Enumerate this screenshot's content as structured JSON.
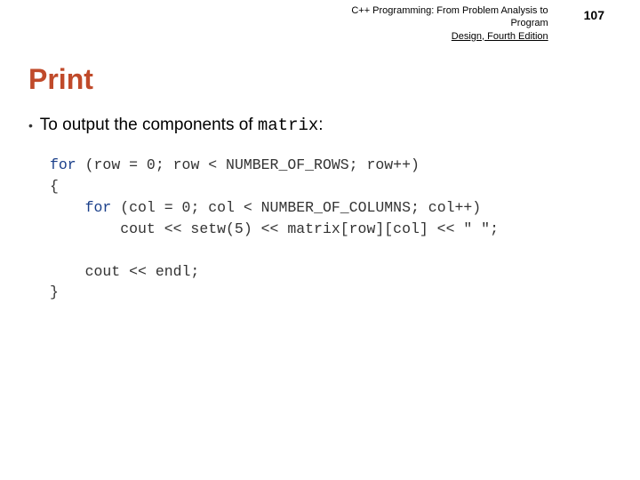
{
  "header": {
    "title_line1": "C++ Programming: From Problem Analysis to Program",
    "title_line2": "Design, Fourth Edition",
    "page_number": "107"
  },
  "slide": {
    "title": "Print",
    "bullet_prefix": "• ",
    "bullet_text_before": "To output the components of ",
    "bullet_mono": "matrix",
    "bullet_text_after": ":"
  },
  "code": {
    "kw_for1": "for",
    "line1_rest": " (row = 0; row < NUMBER_OF_ROWS; row++)",
    "line2": "{",
    "line3_indent": "    ",
    "kw_for2": "for",
    "line3_rest": " (col = 0; col < NUMBER_OF_COLUMNS; col++)",
    "line4": "        cout << setw(5) << matrix[row][col] << \" \";",
    "blank": "",
    "line5": "    cout << endl;",
    "line6": "}"
  }
}
